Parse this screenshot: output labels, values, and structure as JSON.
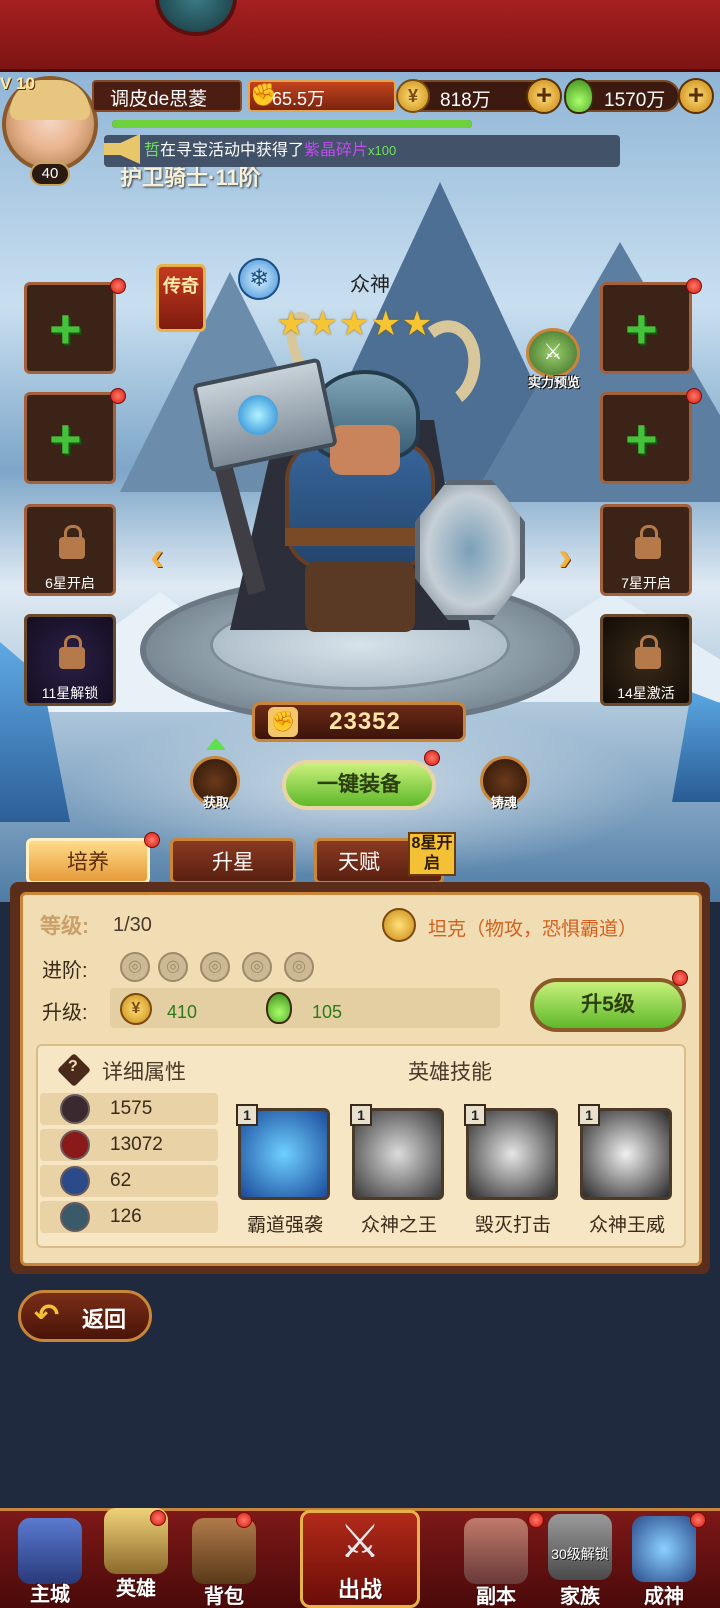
{
  "header": {
    "vip": "V 10",
    "player_level": "40",
    "player_name": "调皮de思菱",
    "power": "65.5万",
    "gold": "818万",
    "potion": "1570万"
  },
  "notice": {
    "user": "哲",
    "text": "在寻宝活动中获得了",
    "item": "紫晶碎片",
    "count": "x100"
  },
  "hero": {
    "title_behind": "护卫骑士·11阶",
    "rarity": "传奇",
    "faction_icon": "snowflake-icon",
    "name": "众神",
    "stars": "★★★★★",
    "star_count": 5,
    "preview_label": "实力预览",
    "power": "23352"
  },
  "slots": {
    "left": [
      {
        "type": "add",
        "label": ""
      },
      {
        "type": "add",
        "label": ""
      },
      {
        "type": "locked",
        "label": "6星开启"
      },
      {
        "type": "locked",
        "label": "11星解锁"
      }
    ],
    "right": [
      {
        "type": "add",
        "label": ""
      },
      {
        "type": "add",
        "label": ""
      },
      {
        "type": "locked",
        "label": "7星开启"
      },
      {
        "type": "locked",
        "label": "14星激活"
      }
    ]
  },
  "actions": {
    "obtain": "获取",
    "equip_all": "一键装备",
    "forge": "铸魂"
  },
  "tabs": {
    "train": "培养",
    "star_up": "升星",
    "talent": "天赋",
    "talent_tag": "8星开启"
  },
  "stats": {
    "level_label": "等级:",
    "level_value": "1/30",
    "role": "坦克（物攻，恐惧霸道）",
    "advance_label": "进阶:",
    "upgrade_label": "升级:",
    "cost_gold": "410",
    "cost_potion": "105",
    "upgrade_button": "升5级"
  },
  "attributes": {
    "title": "详细属性",
    "values": [
      "1575",
      "13072",
      "62",
      "126"
    ]
  },
  "skills": {
    "title": "英雄技能",
    "list": [
      {
        "level": "1",
        "name": "霸道强袭"
      },
      {
        "level": "1",
        "name": "众神之王"
      },
      {
        "level": "1",
        "name": "毁灭打击"
      },
      {
        "level": "1",
        "name": "众神王威"
      }
    ]
  },
  "back_button": "返回",
  "nav": {
    "main_city": "主城",
    "heroes": "英雄",
    "bag": "背包",
    "battle": "出战",
    "dungeon": "副本",
    "clan": "家族",
    "clan_locked": "30级解锁",
    "godhood": "成神"
  },
  "colors": {
    "accent_green": "#5fb82a",
    "banner_red": "#a62020",
    "gold": "#c98a12"
  }
}
